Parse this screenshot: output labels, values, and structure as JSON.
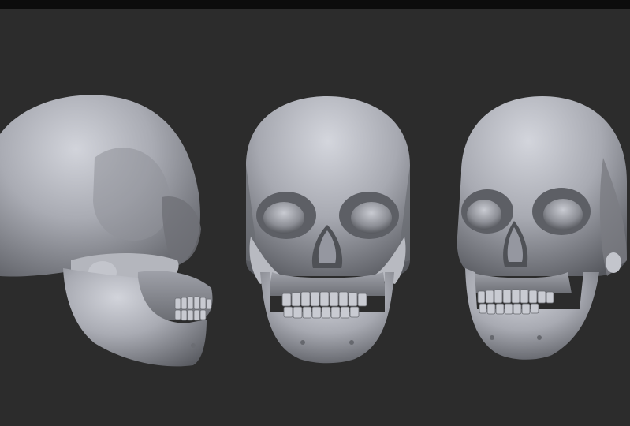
{
  "scene": {
    "background_color": "#2c2c2c",
    "top_bar_color": "#0c0c0c",
    "material_color": "#a9abb3",
    "views": [
      {
        "name": "side-view",
        "orientation": "left-profile"
      },
      {
        "name": "front-view",
        "orientation": "front"
      },
      {
        "name": "three-quarter-view",
        "orientation": "three-quarter-right"
      }
    ]
  }
}
